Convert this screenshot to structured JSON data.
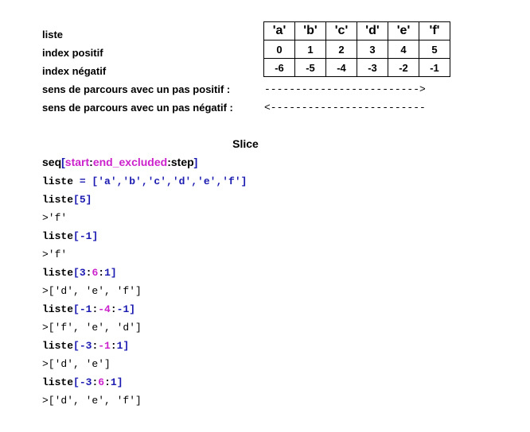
{
  "labels": {
    "liste": "liste",
    "index_positif": "index positif",
    "index_negatif": "index négatif",
    "sens_positif": "sens de parcours avec un pas positif :",
    "sens_negatif": "sens de parcours avec un pas négatif :"
  },
  "table": {
    "letters": [
      "'a'",
      "'b'",
      "'c'",
      "'d'",
      "'e'",
      "'f'"
    ],
    "positive": [
      "0",
      "1",
      "2",
      "3",
      "4",
      "5"
    ],
    "negative": [
      "-6",
      "-5",
      "-4",
      "-3",
      "-2",
      "-1"
    ]
  },
  "arrows": {
    "positive": "------------------------->",
    "negative": "<-------------------------"
  },
  "slice": {
    "title": "Slice",
    "syntax": {
      "seq": "seq",
      "open": "[",
      "start": "start",
      "colon1": ":",
      "end": "end_excluded",
      "colon2": ":",
      "step": "step",
      "close": "]"
    }
  },
  "code": {
    "assign": {
      "name": "liste",
      "rest": " = ['a','b','c','d','e','f']"
    },
    "l1_name": "liste",
    "l1_open": "[",
    "l1_a": "5",
    "l1_close": "]",
    "o1": ">'f'",
    "l2_name": "liste",
    "l2_open": "[",
    "l2_a": "-1",
    "l2_close": "]",
    "o2": ">'f'",
    "l3_name": "liste",
    "l3_open": "[",
    "l3_a": "3",
    "l3_c1": ":",
    "l3_b": "6",
    "l3_c2": ":",
    "l3_c": "1",
    "l3_close": "]",
    "o3": ">['d', 'e', 'f']",
    "l4_name": "liste",
    "l4_open": "[",
    "l4_a": "-1",
    "l4_c1": ":",
    "l4_b": "-4",
    "l4_c2": ":",
    "l4_c": "-1",
    "l4_close": "]",
    "o4": ">['f', 'e', 'd']",
    "l5_name": "liste",
    "l5_open": "[",
    "l5_a": "-3",
    "l5_c1": ":",
    "l5_b": "-1",
    "l5_c2": ":",
    "l5_c": "1",
    "l5_close": "]",
    "o5": ">['d', 'e']",
    "l6_name": "liste",
    "l6_open": "[",
    "l6_a": "-3",
    "l6_c1": ":",
    "l6_b": "6",
    "l6_c2": ":",
    "l6_c": "1",
    "l6_close": "]",
    "o6": ">['d', 'e', 'f']"
  },
  "colors": {
    "blue": "#1a1ab0",
    "magenta": "#cc22cc"
  }
}
